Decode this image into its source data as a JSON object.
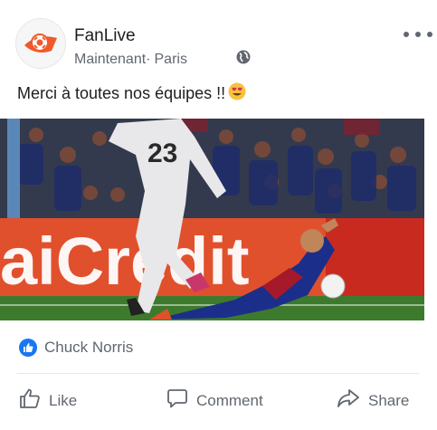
{
  "post": {
    "page_name": "FanLive",
    "time": "Maintenant",
    "separator": "·",
    "location": "Paris",
    "privacy_icon": "globe-icon",
    "text": "Merci à toutes nos équipes !!",
    "emoji_icon": "heart-eyes-emoji",
    "jersey_number": "23",
    "banner_text": "aiCredit"
  },
  "reactions": {
    "icon": "thumbs-up-icon",
    "names": "Chuck Norris"
  },
  "actions": {
    "like_label": "Like",
    "comment_label": "Comment",
    "share_label": "Share"
  },
  "colors": {
    "brand_blue": "#1877f2",
    "text_primary": "#1c1e21",
    "text_secondary": "#616770",
    "logo_orange": "#f0592a"
  }
}
